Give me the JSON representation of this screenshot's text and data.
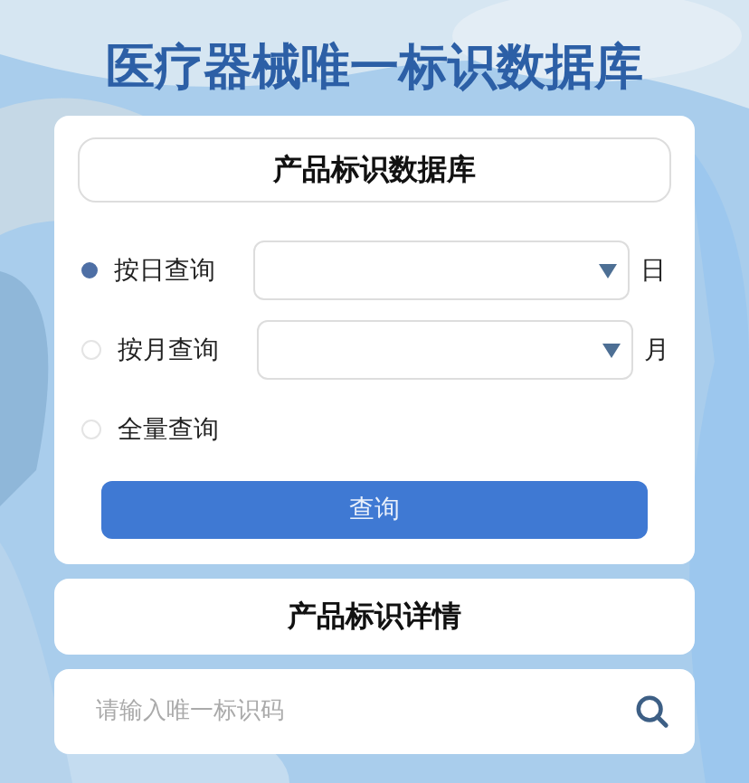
{
  "title": "医疗器械唯一标识数据库",
  "query_card": {
    "heading": "产品标识数据库",
    "options": [
      {
        "kind": "select",
        "label": "按日查询",
        "selected": true,
        "unit": "日"
      },
      {
        "kind": "select",
        "label": "按月查询",
        "selected": false,
        "unit": "月"
      },
      {
        "kind": "plain",
        "label": "全量查询",
        "selected": false
      }
    ],
    "button": "查询"
  },
  "details": {
    "heading": "产品标识详情"
  },
  "search": {
    "placeholder": "请输入唯一标识码"
  }
}
